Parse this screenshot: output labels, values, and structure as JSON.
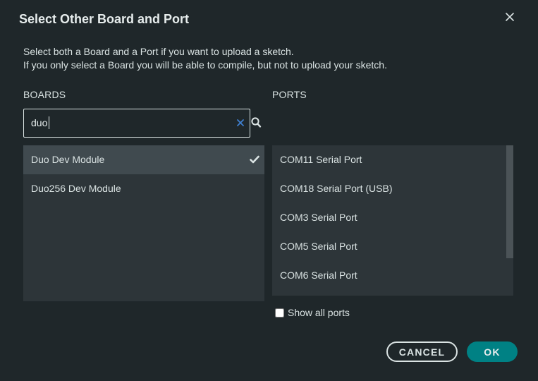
{
  "dialog": {
    "title": "Select Other Board and Port",
    "intro_line1": "Select both a Board and a Port if you want to upload a sketch.",
    "intro_line2": "If you only select a Board you will be able to compile, but not to upload your sketch."
  },
  "boards": {
    "label": "BOARDS",
    "search_value": "duo",
    "items": [
      {
        "label": "Duo Dev Module",
        "selected": true
      },
      {
        "label": "Duo256 Dev Module",
        "selected": false
      }
    ]
  },
  "ports": {
    "label": "PORTS",
    "items": [
      {
        "label": "COM11 Serial Port"
      },
      {
        "label": "COM18 Serial Port (USB)"
      },
      {
        "label": "COM3 Serial Port"
      },
      {
        "label": "COM5 Serial Port"
      },
      {
        "label": "COM6 Serial Port"
      }
    ],
    "show_all_label": "Show all ports",
    "show_all_checked": false
  },
  "buttons": {
    "cancel": "CANCEL",
    "ok": "OK"
  },
  "colors": {
    "background": "#1f272a",
    "list_background": "#2d3539",
    "selected_row": "#404a4f",
    "accent": "#008184",
    "clear_icon": "#1da086"
  },
  "icons": {
    "close": "close-icon",
    "clear": "clear-icon",
    "search": "search-icon",
    "check": "check-icon"
  }
}
